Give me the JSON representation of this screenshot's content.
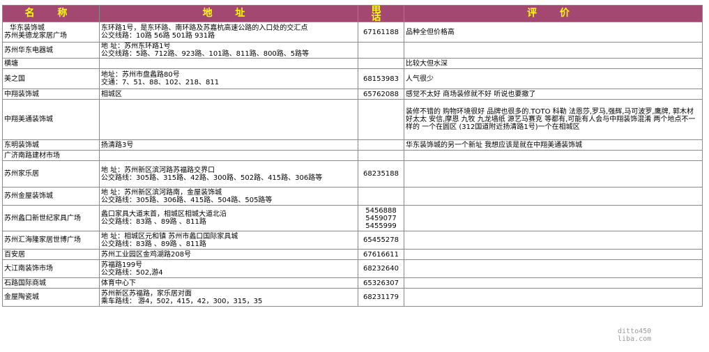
{
  "headers": {
    "name": "名 称",
    "address": "地 址",
    "phone": "电 话",
    "review": "评 价"
  },
  "rows": [
    {
      "name1": "华东装饰城",
      "name2": "苏州美德龙家居广场",
      "addr1": "东环路1号，是东环路、南环路及苏嘉杭高速公路的入口处的交汇点",
      "addr2": "公交线路：10路 56路 501路 931路",
      "addr3": "",
      "phone1": "67161188",
      "phone2": "",
      "phone3": "",
      "review": "品种全但价格高"
    },
    {
      "name1": "苏州华东电器城",
      "name2": "",
      "addr1": "地    址：苏州东环路1号",
      "addr2": "公交线路：5路、712路、923路、101路、811路、800路、5路等",
      "addr3": "",
      "phone1": "",
      "phone2": "",
      "phone3": "",
      "review": ""
    },
    {
      "name1": "横塘",
      "name2": "",
      "addr1": "",
      "addr2": "",
      "addr3": "",
      "phone1": "",
      "phone2": "",
      "phone3": "",
      "review": "比较大但水深"
    },
    {
      "name1": "美之国",
      "name2": "",
      "addr1": "地址：苏州市盘蠡路80号",
      "addr2": "交通：7、51、88、102、218、811",
      "addr3": "",
      "phone1": "68153983",
      "phone2": "",
      "phone3": "",
      "review": "人气很少"
    },
    {
      "name1": "中翔装饰城",
      "name2": "",
      "addr1": "相城区",
      "addr2": "",
      "addr3": "",
      "phone1": "65762088",
      "phone2": "",
      "phone3": "",
      "review": "感觉不太好   商场装修就不好  听说也要撤了"
    },
    {
      "name1": "中翔美通装饰城",
      "name2": "",
      "addr1": "",
      "addr2": "",
      "addr3": "",
      "phone1": "",
      "phone2": "",
      "phone3": "",
      "review": "装修不错的 购物环境很好   品牌也很多的.TOTO 科勒 法恩莎,罗马,强辉,马可波罗,鹰牌, 郭木材 好太太 安信,摩恩 九牧 九龙墙纸 源艺马赛克 等都有,可能有人会与中翔装饰混淆 两个地点不一样的 一个在圆区 (312国道附近扬清路1号)一个在相城区"
    },
    {
      "name1": "东明装饰城",
      "name2": "",
      "addr1": "扬清路3号",
      "addr2": "",
      "addr3": "",
      "phone1": "",
      "phone2": "",
      "phone3": "",
      "review": " 华东装饰城的另一个新址 我想应该是就在中翔美通装饰城"
    },
    {
      "name1": "广济南路建材市场",
      "name2": "",
      "addr1": "",
      "addr2": "",
      "addr3": "",
      "phone1": "",
      "phone2": "",
      "phone3": "",
      "review": ""
    },
    {
      "name1": "苏州家乐居",
      "name2": "",
      "addr1": "地    址：苏州新区滨河路苏福路交界口",
      "addr2": "公交路线：305路、315路、42路、300路、502路、415路、306路等",
      "addr3": "",
      "phone1": "68235188",
      "phone2": "",
      "phone3": "",
      "review": ""
    },
    {
      "name1": "苏州金屋装饰城",
      "name2": "",
      "addr1": "地    址：苏州新区滨河路南，金屋装饰城",
      "addr2": "公交路线：305路、306路、415路、504路、505路等",
      "addr3": "",
      "phone1": "",
      "phone2": "",
      "phone3": "",
      "review": ""
    },
    {
      "name1": "苏州蠡口新世纪家具广场",
      "name2": "",
      "addr1": "蠡口家具大道末首，相城区相城大道北沿",
      "addr2": "公交路线：83路  、89路  、811路",
      "addr3": "",
      "phone1": "5456888",
      "phone2": "5459077",
      "phone3": "5455999",
      "review": ""
    },
    {
      "name1": "苏州汇海隆家居世博广场",
      "name2": "",
      "addr1": "地    址：相城区元和镇  苏州市蠡口国际家具城",
      "addr2": "公交路线：83路  、89路  、811路",
      "addr3": "",
      "phone1": "65455278",
      "phone2": "",
      "phone3": "",
      "review": ""
    },
    {
      "name1": "百安居",
      "name2": "",
      "addr1": "苏州工业园区金鸡湖路208号",
      "addr2": "",
      "addr3": "",
      "phone1": "67616611",
      "phone2": "",
      "phone3": "",
      "review": ""
    },
    {
      "name1": "大江南装饰市场",
      "name2": "",
      "addr1": "苏福路199号",
      "addr2": "公交路线：502,游4",
      "addr3": "",
      "phone1": "68232640",
      "phone2": "",
      "phone3": "",
      "review": ""
    },
    {
      "name1": "石路国际商城",
      "name2": "",
      "addr1": "体育中心下",
      "addr2": "",
      "addr3": "",
      "phone1": "65326307",
      "phone2": "",
      "phone3": "",
      "review": ""
    },
    {
      "name1": "金屋陶瓷城",
      "name2": "",
      "addr1": "苏州新区苏福路，家乐居对面",
      "addr2": "乘车路线： 游4，502，415，42，300，315，35",
      "addr3": "",
      "phone1": "68231179",
      "phone2": "",
      "phone3": "",
      "review": ""
    }
  ],
  "watermark": {
    "line1": "ditto450",
    "line2": "liba.com"
  }
}
